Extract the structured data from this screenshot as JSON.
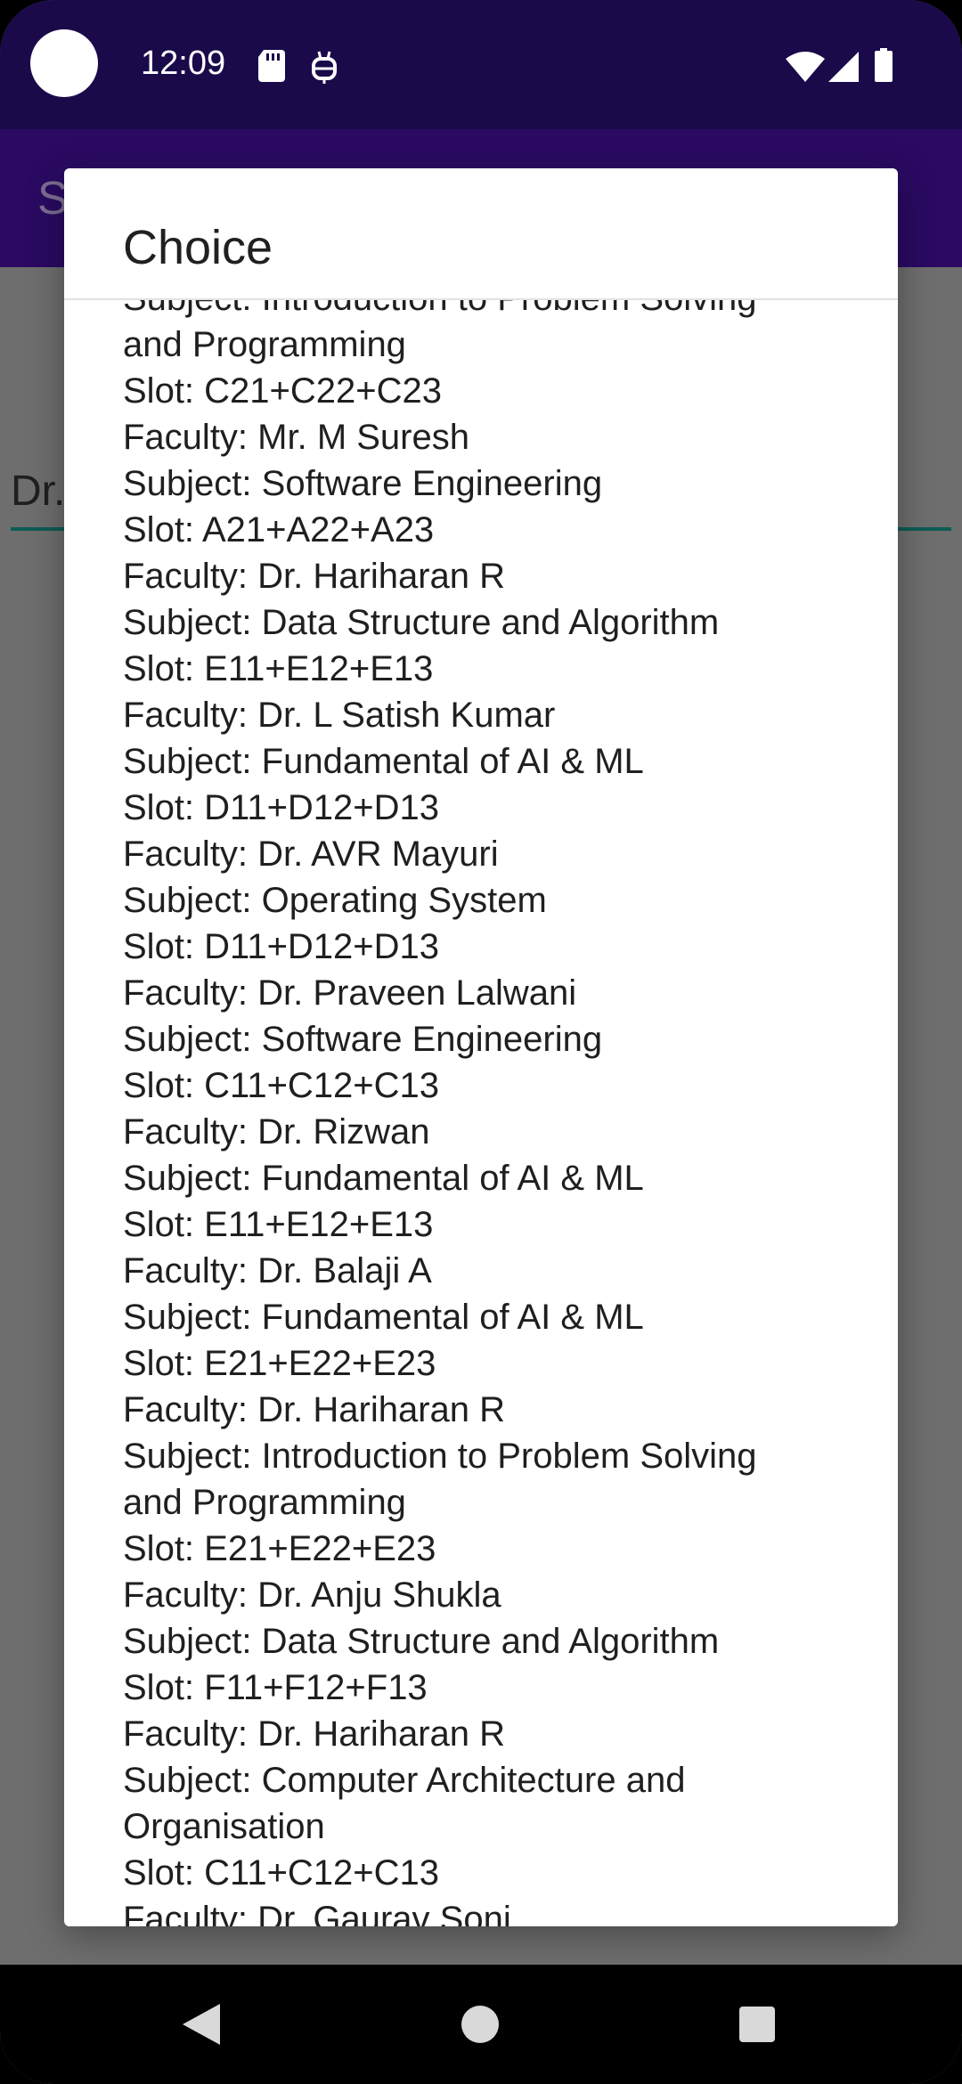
{
  "status_bar": {
    "time": "12:09"
  },
  "app_bar": {
    "title": "S"
  },
  "background": {
    "field_text": "Dr."
  },
  "dialog": {
    "title": "Choice",
    "lines": [
      "Subject: Introduction to Problem Solving",
      "and Programming",
      "Slot: C21+C22+C23",
      "Faculty: Mr. M Suresh",
      "Subject: Software Engineering",
      "Slot: A21+A22+A23",
      "Faculty: Dr. Hariharan R",
      "Subject: Data Structure and Algorithm",
      "Slot: E11+E12+E13",
      "Faculty: Dr. L Satish Kumar",
      "Subject: Fundamental of AI & ML",
      "Slot: D11+D12+D13",
      "Faculty: Dr. AVR Mayuri",
      "Subject: Operating System",
      "Slot: D11+D12+D13",
      "Faculty: Dr. Praveen Lalwani",
      "Subject: Software Engineering",
      "Slot: C11+C12+C13",
      "Faculty: Dr. Rizwan",
      "Subject: Fundamental of AI & ML",
      "Slot: E11+E12+E13",
      "Faculty: Dr. Balaji A",
      "Subject: Fundamental of AI & ML",
      "Slot: E21+E22+E23",
      "Faculty: Dr. Hariharan R",
      "Subject: Introduction to Problem Solving",
      "and Programming",
      "Slot: E21+E22+E23",
      "Faculty: Dr. Anju Shukla",
      "Subject: Data Structure and Algorithm",
      "Slot: F11+F12+F13",
      "Faculty: Dr. Hariharan R",
      "Subject: Computer Architecture and",
      "Organisation",
      "Slot: C11+C12+C13",
      "Faculty: Dr. Gaurav Soni"
    ]
  },
  "icons": {
    "sd": "sd-card-icon",
    "robot": "android-robot-icon",
    "wifi": "wifi-icon",
    "signal": "cell-signal-icon",
    "battery": "battery-icon",
    "back": "back-icon",
    "home": "home-icon",
    "recents": "recents-icon"
  }
}
